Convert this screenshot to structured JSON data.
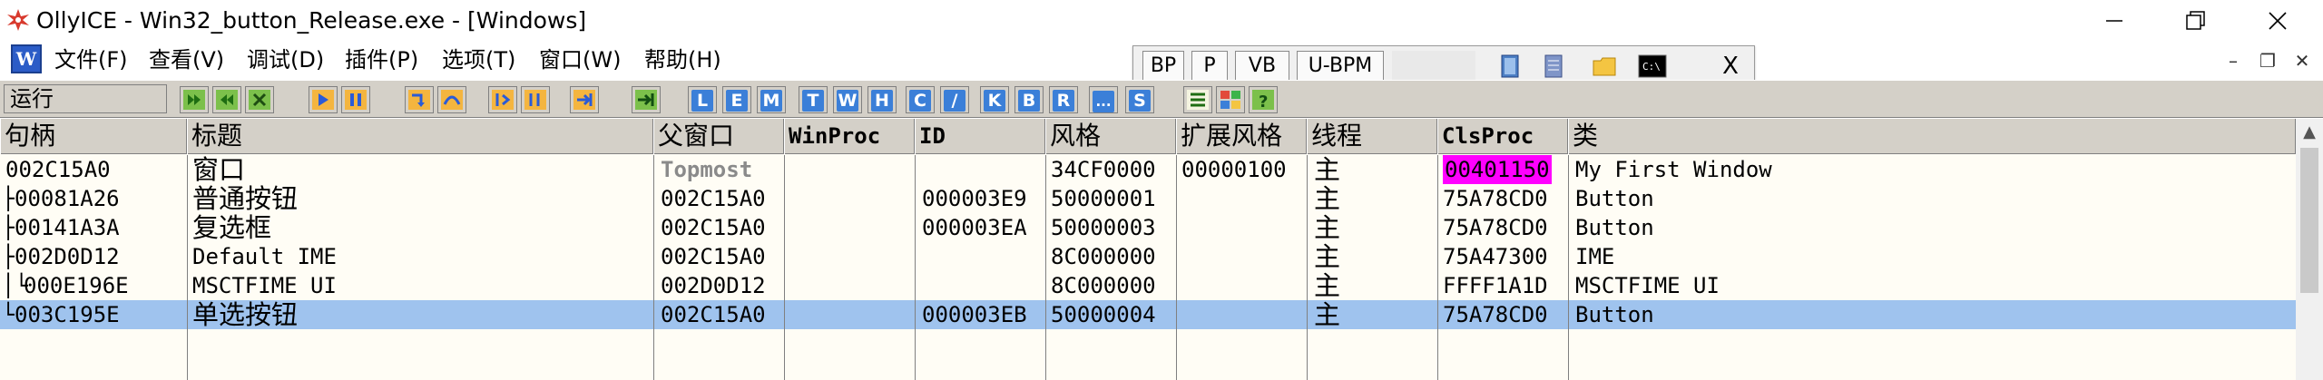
{
  "window": {
    "title": "OllyICE - Win32_button_Release.exe - [Windows]",
    "controls": {
      "minimize": "—",
      "maximize": "❐",
      "close": "✕"
    }
  },
  "menu": {
    "logo": "W",
    "items": [
      "文件(F)",
      "查看(V)",
      "调试(D)",
      "插件(P)",
      "选项(T)",
      "窗口(W)",
      "帮助(H)"
    ]
  },
  "bp_panel": {
    "buttons": [
      "BP",
      "P",
      "VB",
      "U-BPM"
    ],
    "close": "X"
  },
  "mdi_controls": {
    "minimize": "–",
    "restore": "❐",
    "close": "✕"
  },
  "toolbar": {
    "status": "运行",
    "letters": [
      "L",
      "E",
      "M",
      "T",
      "W",
      "H",
      "C",
      "/",
      "K",
      "B",
      "R",
      "...",
      "S"
    ]
  },
  "table": {
    "columns": [
      "句柄",
      "标题",
      "父窗口",
      "WinProc",
      "ID",
      "风格",
      "扩展风格",
      "线程",
      "ClsProc",
      "类"
    ],
    "rows": [
      {
        "tree": "",
        "handle": "002C15A0",
        "title": "窗口",
        "parent": "Topmost",
        "winproc": "",
        "id": "",
        "style": "34CF0000",
        "exstyle": "00000100",
        "thread": "主",
        "clsproc": "00401150",
        "class": "My First Window",
        "selected": false,
        "clsproc_highlight": "#ff00ff"
      },
      {
        "tree": "├",
        "handle": "00081A26",
        "title": "普通按钮",
        "parent": "002C15A0",
        "winproc": "",
        "id": "000003E9",
        "style": "50000001",
        "exstyle": "",
        "thread": "主",
        "clsproc": "75A78CD0",
        "class": "Button",
        "selected": false
      },
      {
        "tree": "├",
        "handle": "00141A3A",
        "title": "复选框",
        "parent": "002C15A0",
        "winproc": "",
        "id": "000003EA",
        "style": "50000003",
        "exstyle": "",
        "thread": "主",
        "clsproc": "75A78CD0",
        "class": "Button",
        "selected": false
      },
      {
        "tree": "├",
        "handle": "002D0D12",
        "title": "Default IME",
        "parent": "002C15A0",
        "winproc": "",
        "id": "",
        "style": "8C000000",
        "exstyle": "",
        "thread": "主",
        "clsproc": "75A47300",
        "class": "IME",
        "selected": false
      },
      {
        "tree": "│└",
        "handle": "000E196E",
        "title": "MSCTFIME UI",
        "parent": "002D0D12",
        "winproc": "",
        "id": "",
        "style": "8C000000",
        "exstyle": "",
        "thread": "主",
        "clsproc": "FFFF1A1D",
        "class": "MSCTFIME UI",
        "selected": false
      },
      {
        "tree": "└",
        "handle": "003C195E",
        "title": "单选按钮",
        "parent": "002C15A0",
        "winproc": "",
        "id": "000003EB",
        "style": "50000004",
        "exstyle": "",
        "thread": "主",
        "clsproc": "75A78CD0",
        "class": "Button",
        "selected": true
      }
    ]
  },
  "colors": {
    "selection": "#9fc3ee",
    "chrome": "#d4d0c8",
    "table_bg": "#fffdf5",
    "highlight_clsproc": "#ff00ff"
  }
}
